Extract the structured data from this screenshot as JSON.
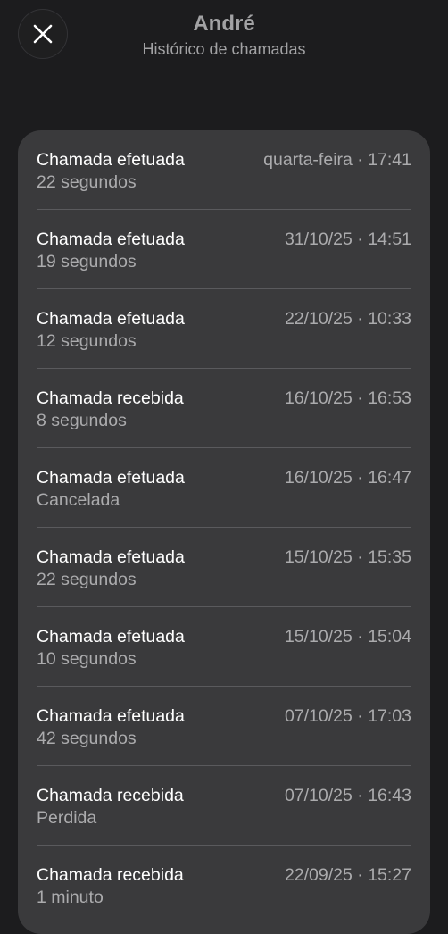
{
  "header": {
    "close_icon": "close-icon",
    "title": "André",
    "subtitle": "Histórico de chamadas"
  },
  "calls": [
    {
      "type": "Chamada efetuada",
      "detail": "22 segundos",
      "time": "quarta-feira · 17:41"
    },
    {
      "type": "Chamada efetuada",
      "detail": "19 segundos",
      "time": "31/10/25 · 14:51"
    },
    {
      "type": "Chamada efetuada",
      "detail": "12 segundos",
      "time": "22/10/25 · 10:33"
    },
    {
      "type": "Chamada recebida",
      "detail": "8 segundos",
      "time": "16/10/25 · 16:53"
    },
    {
      "type": "Chamada efetuada",
      "detail": "Cancelada",
      "time": "16/10/25 · 16:47"
    },
    {
      "type": "Chamada efetuada",
      "detail": "22 segundos",
      "time": "15/10/25 · 15:35"
    },
    {
      "type": "Chamada efetuada",
      "detail": "10 segundos",
      "time": "15/10/25 · 15:04"
    },
    {
      "type": "Chamada efetuada",
      "detail": "42 segundos",
      "time": "07/10/25 · 17:03"
    },
    {
      "type": "Chamada recebida",
      "detail": "Perdida",
      "time": "07/10/25 · 16:43"
    },
    {
      "type": "Chamada recebida",
      "detail": "1 minuto",
      "time": "22/09/25 · 15:27"
    }
  ]
}
